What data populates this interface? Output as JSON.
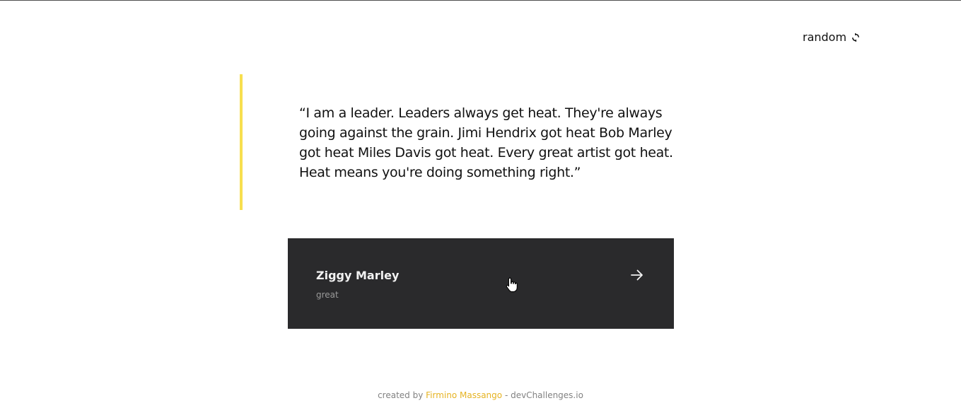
{
  "header": {
    "random_label": "random",
    "random_icon": "refresh-icon"
  },
  "quote": {
    "text": "“I am a leader. Leaders always get heat. They're always going against the grain. Jimi Hendrix got heat Bob Marley got heat Miles Davis got heat. Every great artist got heat. Heat means you're doing something right.”",
    "accent_color": "#f7df4f"
  },
  "author_card": {
    "name": "Ziggy Marley",
    "genre": "great",
    "arrow_icon": "arrow-right-icon",
    "background_color": "#2a2a2c"
  },
  "footer": {
    "prefix": "created by ",
    "author": "Firmino Massango",
    "suffix": " - devChallenges.io",
    "author_color": "#e6b322"
  }
}
